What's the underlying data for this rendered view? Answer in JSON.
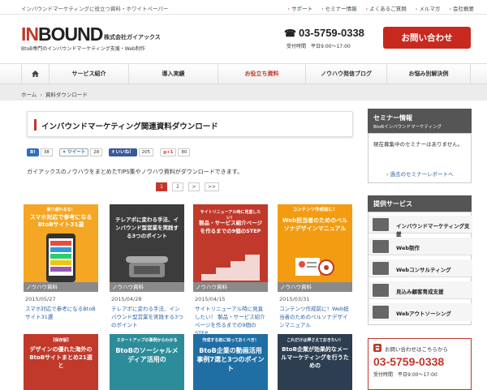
{
  "topbar": {
    "tagline": "インバウンドマーケティングに役立つ資料・ホワイトペーパー",
    "links": [
      "サポート",
      "セミナー情報",
      "よくあるご質問",
      "メルマガ",
      "会社概要"
    ]
  },
  "header": {
    "logo_in": "IN",
    "logo_bound": "BOUND",
    "company": "株式会社ガイアックス",
    "subtitle": "BtoB専門のインバウンドマーケティング支援・Web制作",
    "phone": "03-5759-0338",
    "hours": "受付時間　平日9:00〜17:00",
    "cta": "お問い合わせ"
  },
  "nav": {
    "items": [
      "サービス紹介",
      "導入実績",
      "お役立ち資料",
      "ノウハウ発信ブログ",
      "お悩み別解決例"
    ]
  },
  "breadcrumb": {
    "home": "ホーム",
    "sep": "›",
    "current": "資料ダウンロード"
  },
  "main": {
    "title": "インバウンドマーケティング関連資料ダウンロード",
    "social": {
      "hatena_label": "B!",
      "hatena_count": "38",
      "tweet_label": "ツイート",
      "tweet_count": "28",
      "like_label": "いいね！",
      "like_count": "205",
      "gplus_label": "g+1",
      "gplus_count": "80"
    },
    "lead": "ガイアックスのノウハウをまとめたTIPS集やノウハウ資料がダウンロードできます。",
    "pager": [
      "1",
      "2",
      ">",
      ">>"
    ],
    "cards": [
      {
        "thumb_top": "乗り遅れるな！",
        "thumb_title": "スマホ対応で参考になるBtoBサイト31選",
        "badge": "ノウハウ資料",
        "date": "2015/05/27",
        "title": "スマホ対応で参考になるBtoBサイト31選"
      },
      {
        "thumb_title": "テレアポに変わる手法、インバウンド型営業を実践する3つのポイント",
        "badge": "ノウハウ資料",
        "date": "2015/04/28",
        "title": "テレアポに変わる手法、インバウンド型営業を実践する3つのポイント"
      },
      {
        "thumb_top": "サイトリニューアル時に見直したい！",
        "thumb_title": "製品・サービス紹介ページを作るまでの9個のSTEP",
        "badge": "ノウハウ資料",
        "date": "2015/04/15",
        "title": "サイトリニューアル時に見直したい！ 製品・サービス紹介ページを作るまでの9個のSTEP"
      },
      {
        "thumb_top": "コンテンツ作成前に！",
        "thumb_title": "Web担当者のためのペルソナデザインマニュアル",
        "badge": "ノウハウ資料",
        "date": "2015/03/31",
        "title": "コンテンツ作成前に！Web担当者のためのペルソナデザインマニュアル"
      }
    ],
    "cards_row2": [
      {
        "top": "【保存版】",
        "title": "デザインの優れた海外のBtoBサイトまとめ21選と"
      },
      {
        "top": "スタートアップの事例からわかる",
        "title": "BtoBのソーシャルメディア活用の"
      },
      {
        "top": "作成する前に知っておくべき！",
        "title": "BtoB企業の動画活用事例7選と3つのポイント"
      },
      {
        "top": "これだけは押さえておきたい！",
        "title": "BtoB企業が効果的なメールマーケティングを行うための"
      }
    ]
  },
  "sidebar": {
    "seminar_head": "セミナー情報",
    "seminar_sub": "BtoBインバウンドマーケティング",
    "seminar_body": "現在募集中のセミナーはありません。",
    "seminar_link": "過去のセミナーレポートへ",
    "service_head": "提供サービス",
    "services": [
      "インバウンドマーケティング支援",
      "Web制作",
      "Webコンサルティング",
      "見込み顧客育成支援",
      "Webアウトソーシング"
    ],
    "contact_head": "お問い合わせはこちらから",
    "contact_phone": "03-5759-0338",
    "contact_hours": "受付時間　平日9:00〜17:00"
  },
  "colors": {
    "accent": "#c0392b",
    "nav_active": "#c0392b",
    "sidebar_head": "#555555"
  }
}
